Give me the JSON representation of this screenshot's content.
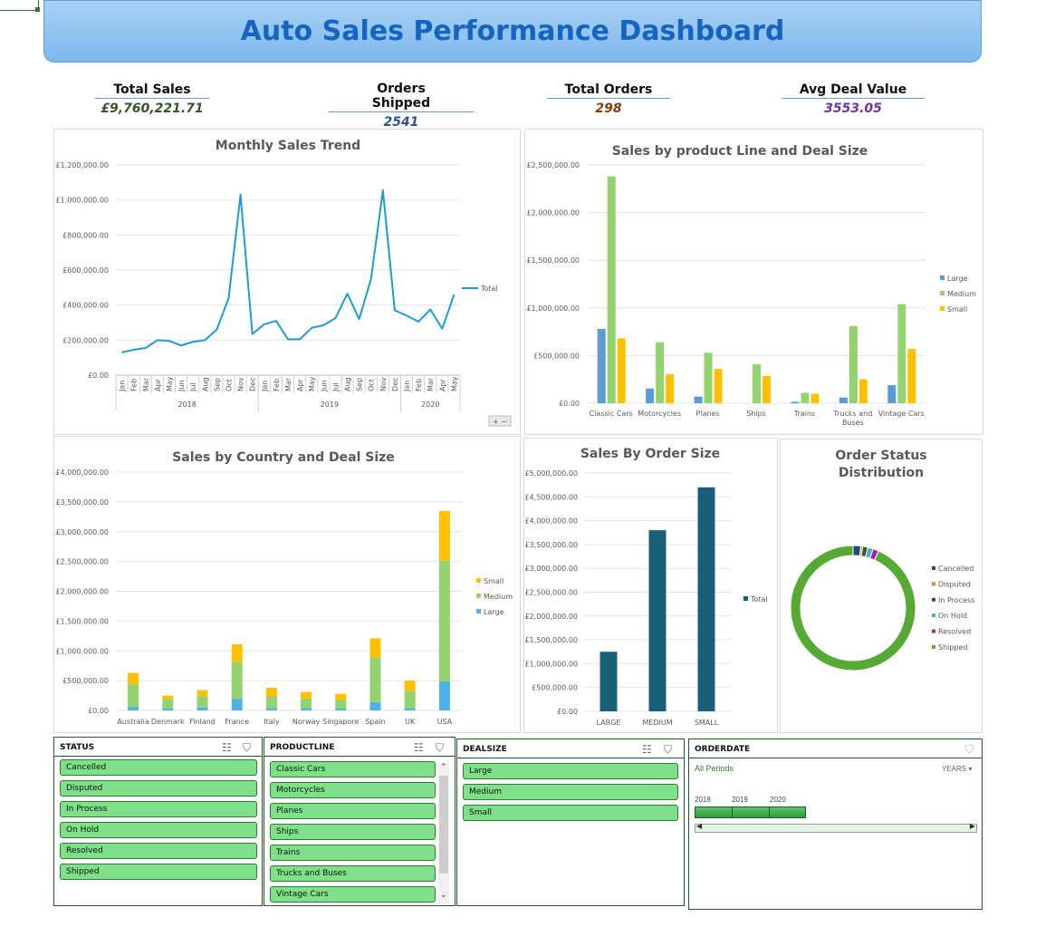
{
  "title": "Auto Sales Performance Dashboard",
  "kpis": [
    {
      "label": "Total Sales",
      "value": "£9,760,221.71",
      "color": "#375623"
    },
    {
      "label": "Orders Shipped",
      "value": "2541",
      "color": "#2f5597"
    },
    {
      "label": "Total Orders",
      "value": "298",
      "color": "#843c0c"
    },
    {
      "label": "Avg Deal Value",
      "value": "3553.05",
      "color": "#7030a0"
    }
  ],
  "chart_data": [
    {
      "type": "line",
      "title": "Monthly Sales Trend",
      "y_ticks": [
        "£0.00",
        "£200,000.00",
        "£400,000.00",
        "£600,000.00",
        "£800,000.00",
        "£1,000,000.00",
        "£1,200,000.00"
      ],
      "ylim": [
        0,
        1200000
      ],
      "months": [
        "Jan",
        "Feb",
        "Mar",
        "Apr",
        "May",
        "Jun",
        "Jul",
        "Aug",
        "Sep",
        "Oct",
        "Nov",
        "Dec",
        "Jan",
        "Feb",
        "Mar",
        "Apr",
        "May",
        "Jun",
        "Jul",
        "Aug",
        "Sep",
        "Oct",
        "Nov",
        "Dec",
        "Jan",
        "Feb",
        "Mar",
        "Apr",
        "May"
      ],
      "years": [
        {
          "label": "2018",
          "count": 12
        },
        {
          "label": "2019",
          "count": 12
        },
        {
          "label": "2020",
          "count": 5
        }
      ],
      "series": [
        {
          "name": "Total",
          "color": "#1f9bd1",
          "values": [
            130000,
            145000,
            155000,
            200000,
            195000,
            170000,
            190000,
            200000,
            260000,
            440000,
            1030000,
            235000,
            290000,
            310000,
            205000,
            205000,
            270000,
            285000,
            325000,
            465000,
            320000,
            550000,
            1055000,
            370000,
            340000,
            305000,
            375000,
            265000,
            460000
          ]
        }
      ],
      "legend_position": "right"
    },
    {
      "type": "bar",
      "title": "Sales by product Line and Deal Size",
      "y_ticks": [
        "£0.00",
        "£500,000.00",
        "£1,000,000.00",
        "£1,500,000.00",
        "£2,000,000.00",
        "£2,500,000.00"
      ],
      "ylim": [
        0,
        2500000
      ],
      "categories": [
        "Classic Cars",
        "Motorcycles",
        "Planes",
        "Ships",
        "Trains",
        "Trucks and Buses",
        "Vintage Cars"
      ],
      "series": [
        {
          "name": "Large",
          "color": "#5b9bd5",
          "values": [
            780000,
            155000,
            70000,
            0,
            15000,
            60000,
            190000
          ]
        },
        {
          "name": "Medium",
          "color": "#92d36e",
          "values": [
            2380000,
            640000,
            530000,
            410000,
            110000,
            810000,
            1040000
          ]
        },
        {
          "name": "Small",
          "color": "#ffc000",
          "values": [
            680000,
            305000,
            360000,
            285000,
            100000,
            250000,
            570000
          ]
        }
      ],
      "legend_position": "right"
    },
    {
      "type": "bar",
      "stacked": true,
      "title": "Sales by Country and Deal Size",
      "y_ticks": [
        "£0.00",
        "£500,000.00",
        "£1,000,000.00",
        "£1,500,000.00",
        "£2,000,000.00",
        "£2,500,000.00",
        "£3,000,000.00",
        "£3,500,000.00",
        "£4,000,000.00"
      ],
      "ylim": [
        0,
        4000000
      ],
      "categories": [
        "Australia",
        "Denmark",
        "Finland",
        "France",
        "Italy",
        "Norway",
        "Singapore",
        "Spain",
        "UK",
        "USA"
      ],
      "series": [
        {
          "name": "Large",
          "color": "#4db3e6",
          "values": [
            60000,
            30000,
            50000,
            190000,
            40000,
            40000,
            30000,
            140000,
            40000,
            490000
          ]
        },
        {
          "name": "Medium",
          "color": "#92d36e",
          "values": [
            380000,
            160000,
            190000,
            620000,
            200000,
            160000,
            150000,
            750000,
            290000,
            2030000
          ]
        },
        {
          "name": "Small",
          "color": "#ffc000",
          "values": [
            190000,
            60000,
            100000,
            300000,
            140000,
            110000,
            100000,
            320000,
            170000,
            830000
          ]
        }
      ],
      "legend_order": [
        "Small",
        "Medium",
        "Large"
      ],
      "legend_position": "right"
    },
    {
      "type": "bar",
      "title": "Sales By Order Size",
      "y_ticks": [
        "£0.00",
        "£500,000.00",
        "£1,000,000.00",
        "£1,500,000.00",
        "£2,000,000.00",
        "£2,500,000.00",
        "£3,000,000.00",
        "£3,500,000.00",
        "£4,000,000.00",
        "£4,500,000.00",
        "£5,000,000.00"
      ],
      "ylim": [
        0,
        5000000
      ],
      "categories": [
        "LARGE",
        "MEDIUM",
        "SMALL"
      ],
      "series": [
        {
          "name": "Total",
          "color": "#1a5f7a",
          "values": [
            1250000,
            3800000,
            4700000
          ]
        }
      ],
      "legend_position": "right"
    },
    {
      "type": "pie",
      "donut": true,
      "title": [
        "Order Status",
        "Distribution"
      ],
      "categories": [
        "Cancelled",
        "Disputed",
        "In Process",
        "On Hold",
        "Resolved",
        "Shipped"
      ],
      "values": [
        2.0,
        0.5,
        1.3,
        1.4,
        1.5,
        93.3
      ],
      "colors": [
        "#1f4e79",
        "#ed7d31",
        "#375623",
        "#4bacc6",
        "#9c27b0",
        "#55aa33"
      ],
      "legend_position": "right"
    }
  ],
  "slicers": {
    "status": {
      "header": "STATUS",
      "items": [
        "Cancelled",
        "Disputed",
        "In Process",
        "On Hold",
        "Resolved",
        "Shipped"
      ]
    },
    "productline": {
      "header": "PRODUCTLINE",
      "items": [
        "Classic Cars",
        "Motorcycles",
        "Planes",
        "Ships",
        "Trains",
        "Trucks and Buses",
        "Vintage Cars"
      ]
    },
    "dealsize": {
      "header": "DEALSIZE",
      "items": [
        "Large",
        "Medium",
        "Small"
      ]
    },
    "orderdate": {
      "header": "ORDERDATE",
      "period_label": "All Periods",
      "level": "YEARS",
      "years": [
        "2018",
        "2019",
        "2020"
      ]
    }
  },
  "chart_controls": {
    "zoom_label": "+ −"
  },
  "icons": {
    "multiselect": "multiselect-icon",
    "clear_filter": "clear-filter-icon"
  }
}
